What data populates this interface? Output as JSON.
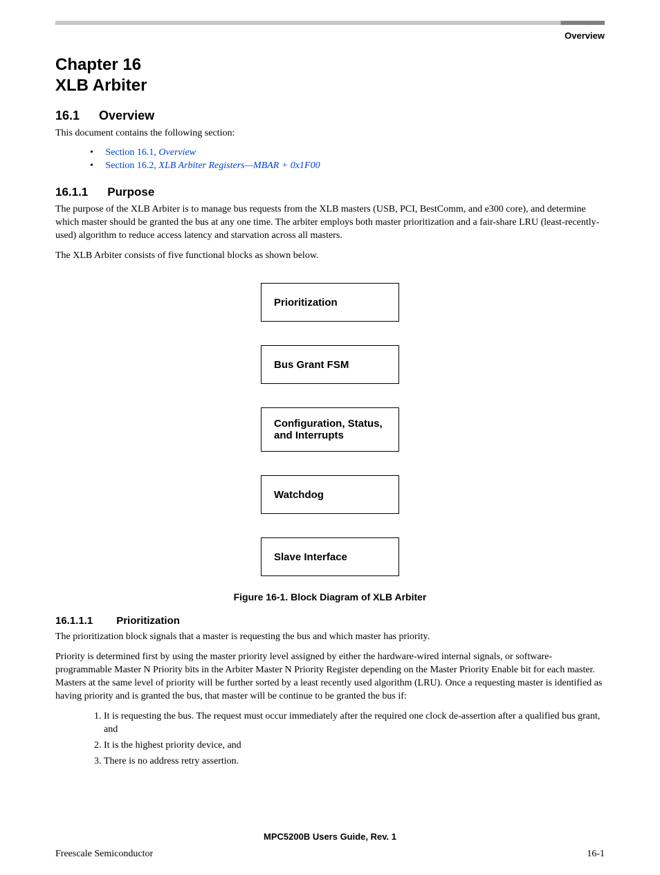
{
  "header": {
    "section_label": "Overview"
  },
  "chapter": {
    "line1": "Chapter 16",
    "line2": "XLB Arbiter"
  },
  "section_overview": {
    "num": "16.1",
    "title": "Overview",
    "intro": "This document contains the following section:",
    "toc": [
      {
        "ref": "Section 16.1, ",
        "title": "Overview"
      },
      {
        "ref": "Section 16.2, ",
        "title": "XLB Arbiter Registers—MBAR + 0x1F00"
      }
    ]
  },
  "section_purpose": {
    "num": "16.1.1",
    "title": "Purpose",
    "p1": "The purpose of the XLB Arbiter is to manage bus requests from the XLB masters (USB, PCI, BestComm, and e300 core), and determine which master should be granted the bus at any one time. The arbiter employs both master prioritization and a fair-share LRU (least-recently-used) algorithm to reduce access latency and starvation across all masters.",
    "p2": "The XLB Arbiter consists of five functional blocks as shown below."
  },
  "diagram": {
    "blocks": [
      "Prioritization",
      "Bus Grant FSM",
      "Configuration, Status, and Interrupts",
      "Watchdog",
      "Slave Interface"
    ],
    "caption": "Figure 16-1. Block Diagram of XLB Arbiter"
  },
  "section_prioritization": {
    "num": "16.1.1.1",
    "title": "Prioritization",
    "p1": "The prioritization block signals that a master is requesting the bus and which master has priority.",
    "p2": "Priority is determined first by using the master priority level assigned by either the hardware-wired internal signals, or software-programmable Master N Priority bits in the Arbiter Master N Priority Register depending on the Master Priority Enable bit for each master. Masters at the same level of priority will be further sorted by a least recently used algorithm (LRU). Once a requesting master is identified as having priority and is granted the bus, that master will be continue to be granted the bus if:",
    "list": [
      "It is requesting the bus. The request must occur immediately after the required one clock de-assertion after a qualified bus grant, and",
      "It is the highest priority device, and",
      "There is no address retry assertion."
    ]
  },
  "footer": {
    "center": "MPC5200B Users Guide, Rev. 1",
    "left": "Freescale Semiconductor",
    "right": "16-1"
  }
}
